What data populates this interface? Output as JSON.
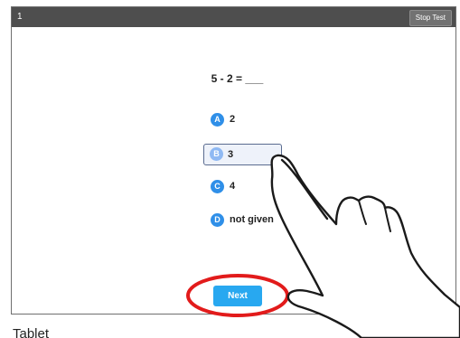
{
  "header": {
    "question_number": "1",
    "stop_label": "Stop Test"
  },
  "question": {
    "text": "5 - 2 = ___"
  },
  "options": [
    {
      "letter": "A",
      "text": "2",
      "selected": false
    },
    {
      "letter": "B",
      "text": "3",
      "selected": true
    },
    {
      "letter": "C",
      "text": "4",
      "selected": false
    },
    {
      "letter": "D",
      "text": "not given",
      "selected": false
    }
  ],
  "next_label": "Next",
  "caption": "Tablet",
  "colors": {
    "accent": "#28a8f0",
    "highlight_circle": "#e21b1b",
    "topbar": "#4e4e4e"
  }
}
